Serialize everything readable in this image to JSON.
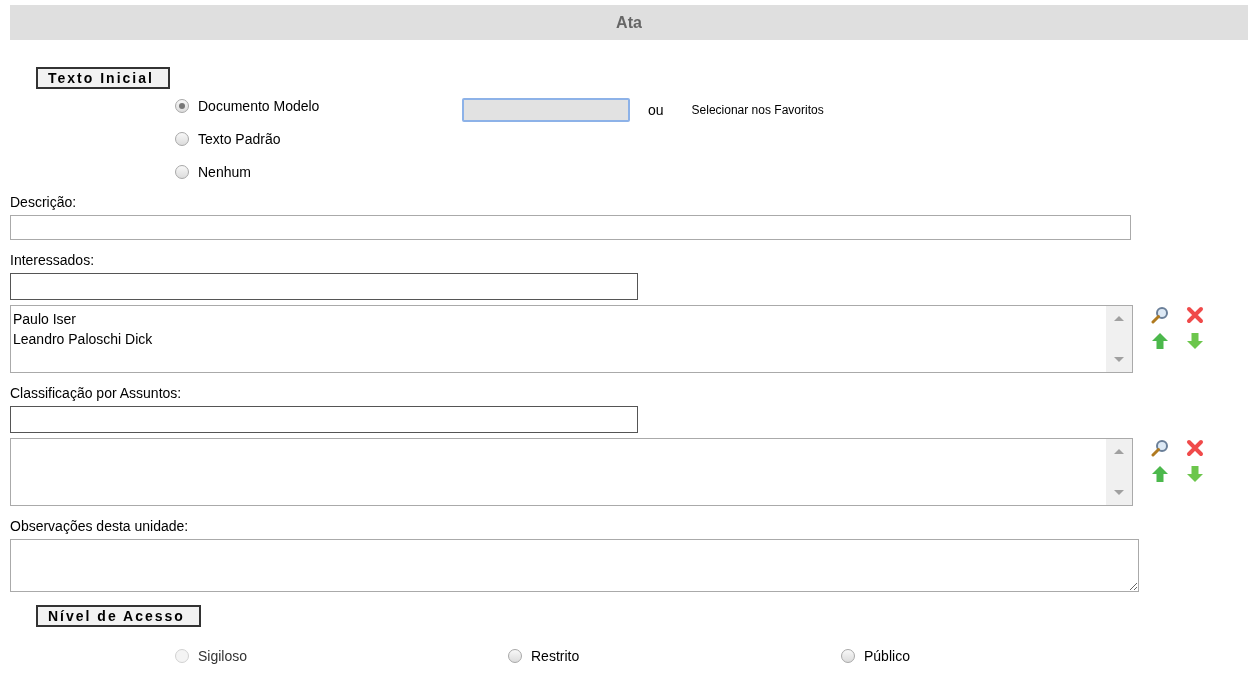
{
  "header": {
    "title": "Ata"
  },
  "texto_inicial": {
    "legend": "Texto Inicial",
    "options": [
      {
        "label": "Documento Modelo",
        "selected": true,
        "disabled": false
      },
      {
        "label": "Texto Padrão",
        "selected": false,
        "disabled": false
      },
      {
        "label": "Nenhum",
        "selected": false,
        "disabled": false
      }
    ],
    "separator": "ou",
    "favorites_link": "Selecionar nos Favoritos"
  },
  "descricao": {
    "label": "Descrição:"
  },
  "interessados": {
    "label": "Interessados:",
    "items": [
      "Paulo Iser",
      "Leandro Paloschi Dick"
    ]
  },
  "classificacao": {
    "label": "Classificação por Assuntos:"
  },
  "observacoes": {
    "label": "Observações desta unidade:"
  },
  "nivel_acesso": {
    "legend": "Nível de Acesso",
    "options": [
      {
        "label": "Sigiloso",
        "selected": false,
        "disabled": true
      },
      {
        "label": "Restrito",
        "selected": false,
        "disabled": false
      },
      {
        "label": "Público",
        "selected": false,
        "disabled": false
      }
    ]
  }
}
